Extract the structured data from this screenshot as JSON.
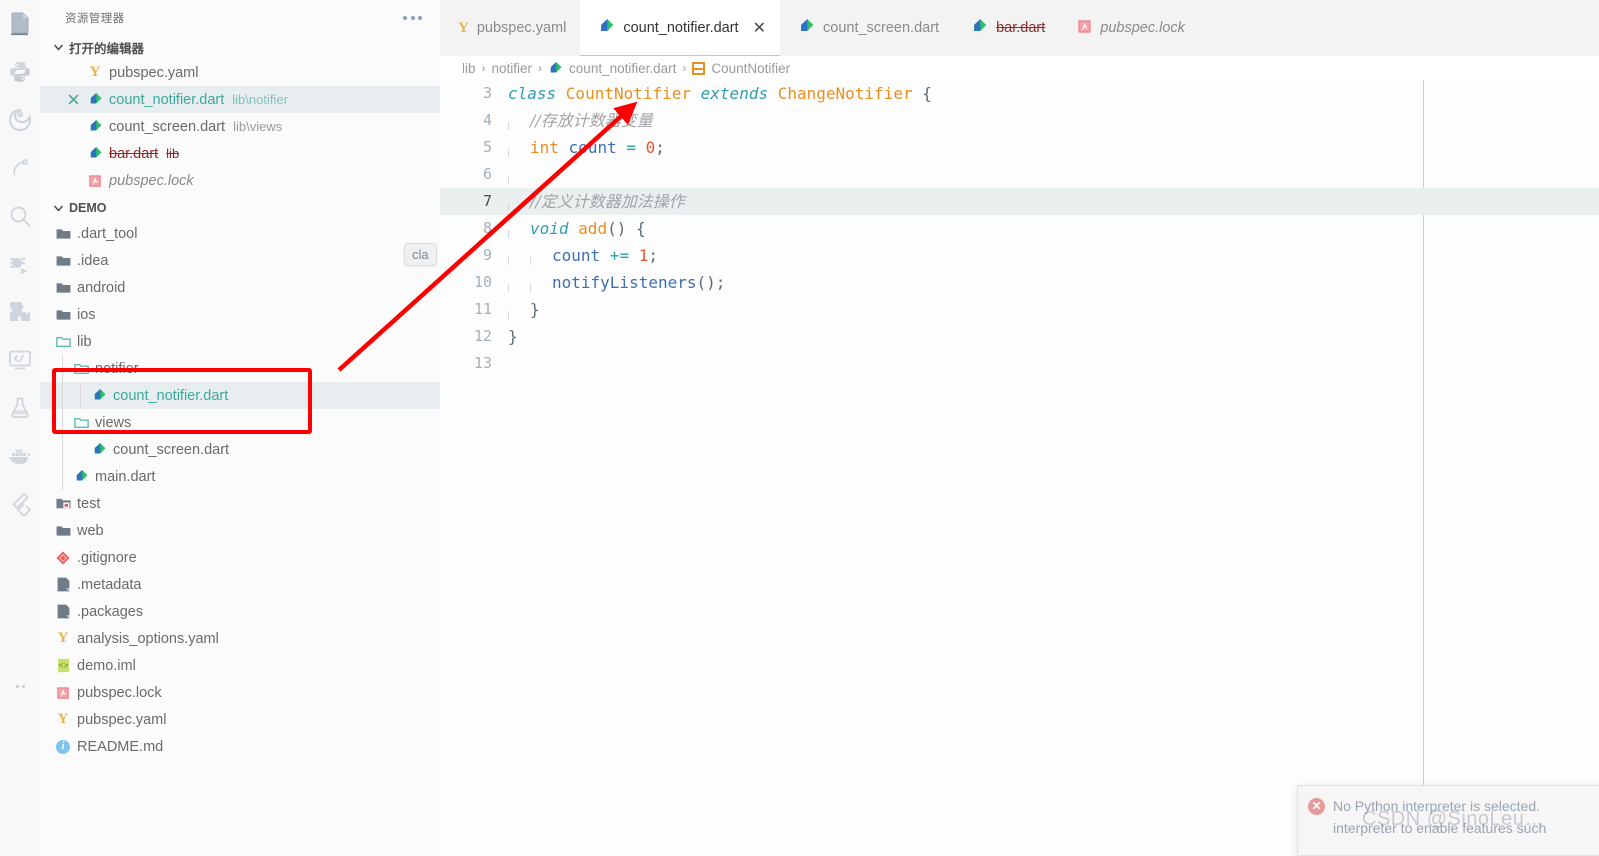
{
  "activity_bar": {
    "items": [
      {
        "name": "explorer-icon",
        "label": "Explorer",
        "active": true
      },
      {
        "name": "python-icon",
        "label": "Python"
      },
      {
        "name": "anaconda-icon",
        "label": "Anaconda"
      },
      {
        "name": "flutter-dart-icon",
        "label": "Dart"
      },
      {
        "name": "search-icon",
        "label": "Search"
      },
      {
        "name": "run-and-debug-icon",
        "label": "Run and Debug"
      },
      {
        "name": "extensions-icon",
        "label": "Extensions"
      },
      {
        "name": "remote-explorer-icon",
        "label": "Remote Explorer"
      },
      {
        "name": "testing-icon",
        "label": "Testing"
      },
      {
        "name": "docker-icon",
        "label": "Docker"
      },
      {
        "name": "flutter-icon",
        "label": "Flutter"
      }
    ],
    "more_label": "..."
  },
  "sidebar": {
    "title": "资源管理器",
    "open_editors": {
      "header": "打开的编辑器",
      "items": [
        {
          "name": "pubspec.yaml",
          "sub": "",
          "icon": "yaml-icon",
          "state": "normal",
          "closable": false
        },
        {
          "name": "count_notifier.dart",
          "sub": "lib\\notifier",
          "icon": "dart-icon",
          "state": "selected",
          "closable": true
        },
        {
          "name": "count_screen.dart",
          "sub": "lib\\views",
          "icon": "dart-icon",
          "state": "normal",
          "closable": false
        },
        {
          "name": "bar.dart",
          "sub": "lib",
          "icon": "dart-icon",
          "state": "deleted",
          "closable": false
        },
        {
          "name": "pubspec.lock",
          "sub": "",
          "icon": "lock-icon",
          "state": "preview",
          "closable": false
        }
      ]
    },
    "project": {
      "header": "DEMO",
      "items": [
        {
          "name": ".dart_tool",
          "icon": "folder-icon",
          "depth": 0
        },
        {
          "name": ".idea",
          "icon": "folder-icon",
          "depth": 0
        },
        {
          "name": "android",
          "icon": "folder-icon",
          "depth": 0
        },
        {
          "name": "ios",
          "icon": "folder-icon",
          "depth": 0
        },
        {
          "name": "lib",
          "icon": "folder-open-icon",
          "depth": 0
        },
        {
          "name": "notifier",
          "icon": "folder-open-icon",
          "depth": 1
        },
        {
          "name": "count_notifier.dart",
          "icon": "dart-icon",
          "depth": 2,
          "state": "selected"
        },
        {
          "name": "views",
          "icon": "folder-open-icon",
          "depth": 1
        },
        {
          "name": "count_screen.dart",
          "icon": "dart-icon",
          "depth": 2
        },
        {
          "name": "main.dart",
          "icon": "dart-icon",
          "depth": 1
        },
        {
          "name": "test",
          "icon": "folder-test-icon",
          "depth": 0
        },
        {
          "name": "web",
          "icon": "folder-icon",
          "depth": 0
        },
        {
          "name": ".gitignore",
          "icon": "git-icon",
          "depth": 0
        },
        {
          "name": ".metadata",
          "icon": "doc-icon",
          "depth": 0
        },
        {
          "name": ".packages",
          "icon": "doc-icon",
          "depth": 0
        },
        {
          "name": "analysis_options.yaml",
          "icon": "yaml-icon",
          "depth": 0
        },
        {
          "name": "demo.iml",
          "icon": "iml-icon",
          "depth": 0
        },
        {
          "name": "pubspec.lock",
          "icon": "lock-icon",
          "depth": 0
        },
        {
          "name": "pubspec.yaml",
          "icon": "yaml-icon",
          "depth": 0
        },
        {
          "name": "README.md",
          "icon": "info-icon",
          "depth": 0
        }
      ]
    }
  },
  "editor": {
    "tabs": [
      {
        "label": "pubspec.yaml",
        "icon": "yaml-icon",
        "active": false,
        "style": "normal",
        "closable": false
      },
      {
        "label": "count_notifier.dart",
        "icon": "dart-icon",
        "active": true,
        "style": "normal",
        "closable": true,
        "close_glyph": "✕"
      },
      {
        "label": "count_screen.dart",
        "icon": "dart-icon",
        "active": false,
        "style": "normal",
        "closable": false
      },
      {
        "label": "bar.dart",
        "icon": "dart-icon",
        "active": false,
        "style": "deleted",
        "closable": false
      },
      {
        "label": "pubspec.lock",
        "icon": "lock-icon",
        "active": false,
        "style": "preview",
        "closable": false
      }
    ],
    "breadcrumb": [
      {
        "label": "lib",
        "icon": ""
      },
      {
        "label": "notifier",
        "icon": ""
      },
      {
        "label": "count_notifier.dart",
        "icon": "dart-icon"
      },
      {
        "label": "CountNotifier",
        "icon": "class-symbol-icon"
      }
    ],
    "breadcrumb_separator": "›",
    "code": {
      "first_line_number": 3,
      "highlighted_line": 7,
      "lines": [
        {
          "n": 3,
          "indent": 0,
          "tokens": [
            {
              "t": "class ",
              "c": "k-kw"
            },
            {
              "t": "CountNotifier ",
              "c": "k-type"
            },
            {
              "t": "extends ",
              "c": "k-kw"
            },
            {
              "t": "ChangeNotifier ",
              "c": "k-type"
            },
            {
              "t": "{",
              "c": "k-punct"
            }
          ]
        },
        {
          "n": 4,
          "indent": 1,
          "tokens": [
            {
              "t": "//存放计数器变量",
              "c": "k-cmt"
            }
          ]
        },
        {
          "n": 5,
          "indent": 1,
          "tokens": [
            {
              "t": "int",
              "c": "k-type"
            },
            {
              "t": " ",
              "c": "k-punct"
            },
            {
              "t": "count",
              "c": "k-ident"
            },
            {
              "t": " = ",
              "c": "k-op"
            },
            {
              "t": "0",
              "c": "k-num"
            },
            {
              "t": ";",
              "c": "k-punct"
            }
          ]
        },
        {
          "n": 6,
          "indent": 1,
          "tokens": []
        },
        {
          "n": 7,
          "indent": 1,
          "tokens": [
            {
              "t": "//定义计数器加法操作",
              "c": "k-cmt"
            }
          ]
        },
        {
          "n": 8,
          "indent": 1,
          "tokens": [
            {
              "t": "void",
              "c": "k-kw"
            },
            {
              "t": " ",
              "c": "k-punct"
            },
            {
              "t": "add",
              "c": "k-type"
            },
            {
              "t": "() {",
              "c": "k-punct"
            }
          ]
        },
        {
          "n": 9,
          "indent": 2,
          "tokens": [
            {
              "t": "count",
              "c": "k-ident"
            },
            {
              "t": " += ",
              "c": "k-op"
            },
            {
              "t": "1",
              "c": "k-num"
            },
            {
              "t": ";",
              "c": "k-punct"
            }
          ]
        },
        {
          "n": 10,
          "indent": 2,
          "tokens": [
            {
              "t": "notifyListeners",
              "c": "k-ident"
            },
            {
              "t": "();",
              "c": "k-punct"
            }
          ]
        },
        {
          "n": 11,
          "indent": 1,
          "tokens": [
            {
              "t": "}",
              "c": "k-punct"
            }
          ]
        },
        {
          "n": 12,
          "indent": 0,
          "tokens": [
            {
              "t": "}",
              "c": "k-punct"
            }
          ]
        },
        {
          "n": 13,
          "indent": 0,
          "tokens": []
        }
      ]
    }
  },
  "annotations": {
    "red_box_target": "count_notifier.dart under lib/notifier",
    "arrow_color": "#ff0000",
    "box_color": "#ff0000",
    "tooltip": "cla"
  },
  "notification": {
    "icon": "error-icon",
    "line1": "No Python interpreter is selected.",
    "line2": "interpreter to enable features such"
  },
  "watermark": {
    "text": "CSDN @SinoLeu…"
  }
}
